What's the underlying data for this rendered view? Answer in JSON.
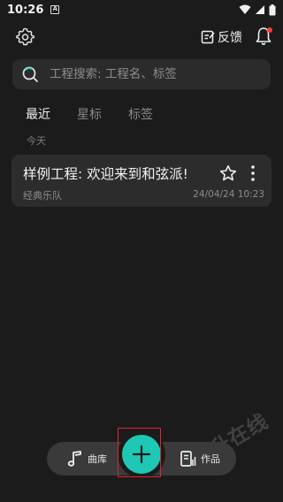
{
  "status_bar": {
    "time": "10:26",
    "notification_glyph": "A",
    "icons": [
      "wifi-icon",
      "signal-icon",
      "battery-icon"
    ]
  },
  "top_bar": {
    "feedback_label": "反馈",
    "icons": [
      "gear-icon",
      "feedback-icon",
      "bell-icon"
    ]
  },
  "search": {
    "placeholder": "工程搜索: 工程名、标签"
  },
  "tabs": [
    {
      "label": "最近",
      "active": true
    },
    {
      "label": "星标",
      "active": false
    },
    {
      "label": "标签",
      "active": false
    }
  ],
  "section": {
    "today_label": "今天"
  },
  "projects": [
    {
      "title": "样例工程: 欢迎来到和弦派!",
      "tag": "经典乐队",
      "date": "24/04/24 10:23"
    }
  ],
  "bottom_nav": {
    "library_label": "曲库",
    "works_label": "作品",
    "add_icon": "plus-icon"
  },
  "watermark": {
    "text": "日升在线"
  },
  "colors": {
    "background": "#1b1b1b",
    "card": "#2c2c2c",
    "accent": "#1ec8b4",
    "highlight": "#e0252a",
    "notification_dot": "#ff3b30"
  }
}
